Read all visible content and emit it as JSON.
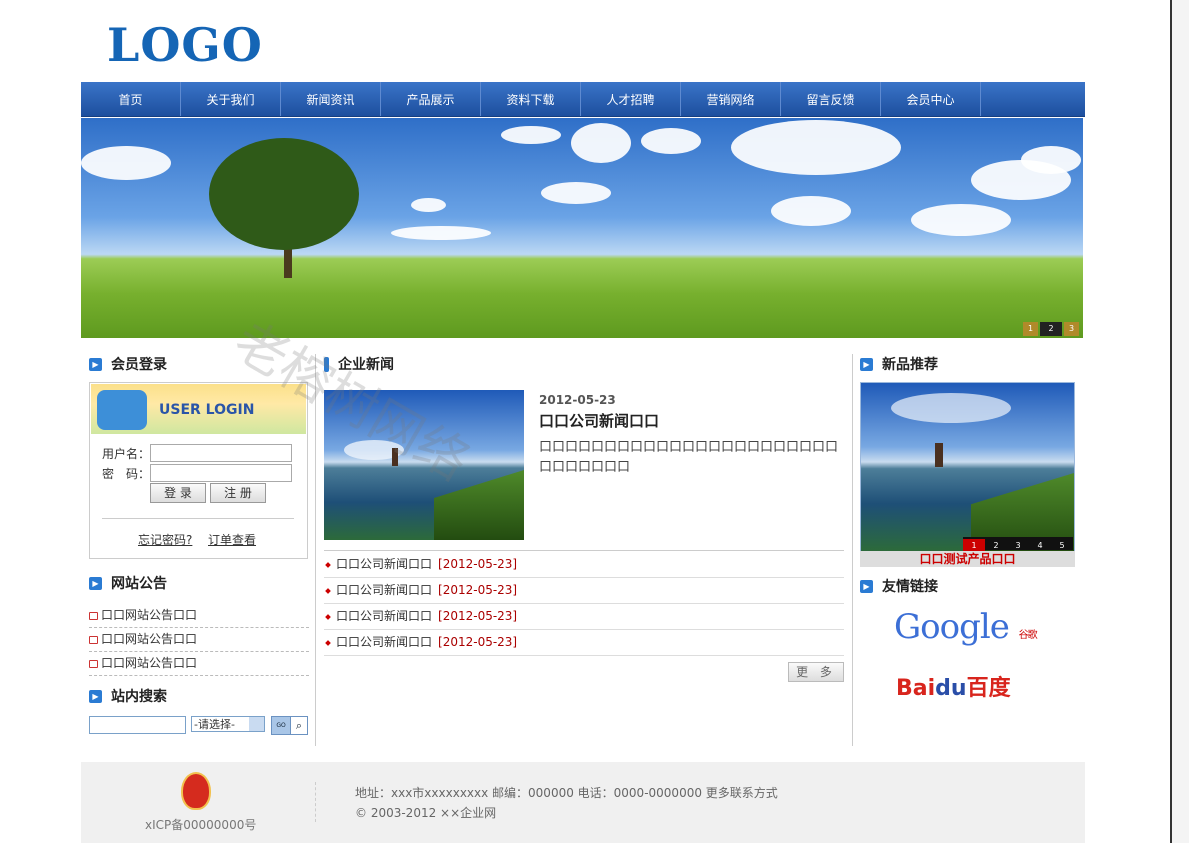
{
  "logo": "LOGO",
  "nav": [
    "首页",
    "关于我们",
    "新闻资讯",
    "产品展示",
    "资料下载",
    "人才招聘",
    "营销网络",
    "留言反馈",
    "会员中心"
  ],
  "banner": {
    "pages": [
      "1",
      "2",
      "3"
    ],
    "active": "2"
  },
  "login": {
    "title": "会员登录",
    "banner_text": "USER LOGIN",
    "username_label": "用户名：",
    "password_label": "密　码：",
    "login_button": "登 录",
    "register_button": "注 册",
    "forgot": "忘记密码?",
    "orders": "订单查看"
  },
  "notices": {
    "title": "网站公告",
    "items": [
      "口口网站公告口口",
      "口口网站公告口口",
      "口口网站公告口口"
    ]
  },
  "search": {
    "title": "站内搜索",
    "select_value": "-请选择-",
    "go": "GO"
  },
  "news": {
    "title": "企业新闻",
    "featured": {
      "date": "2012-05-23",
      "title": "口口公司新闻口口",
      "desc": "口口口口口口口口口口口口口口口口口口口口口口口口口口口口口口"
    },
    "items": [
      {
        "title": "口口公司新闻口口",
        "date": "[2012-05-23]"
      },
      {
        "title": "口口公司新闻口口",
        "date": "[2012-05-23]"
      },
      {
        "title": "口口公司新闻口口",
        "date": "[2012-05-23]"
      },
      {
        "title": "口口公司新闻口口",
        "date": "[2012-05-23]"
      }
    ],
    "more": "更 多"
  },
  "products": {
    "title": "新品推荐",
    "pages": [
      "1",
      "2",
      "3",
      "4",
      "5"
    ],
    "active": "1",
    "caption": "口口测试产品口口"
  },
  "links": {
    "title": "友情链接",
    "google": "Google",
    "google_sub": "谷歌",
    "baidu_a": "Bai",
    "baidu_b": "du",
    "baidu_c": "百度"
  },
  "watermark": "老榕树网络",
  "footer": {
    "icp": "xICP备00000000号",
    "address": "地址：xxx市xxxxxxxxx   邮编：000000   电话：0000-0000000     更多联系方式",
    "copyright": "© 2003-2012 ××企业网"
  }
}
